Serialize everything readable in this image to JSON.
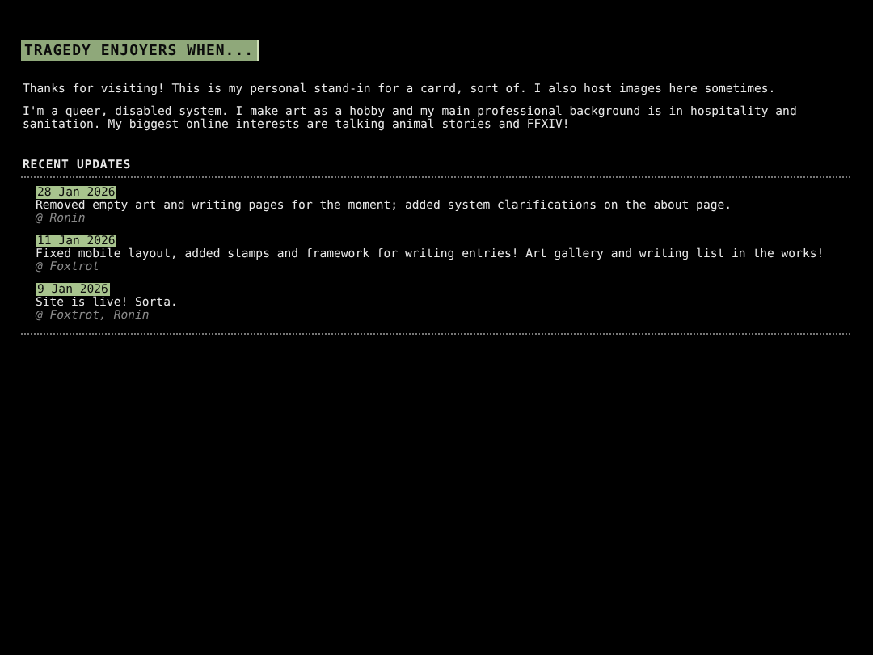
{
  "title": "TRAGEDY ENJOYERS WHEN...",
  "intro": [
    "Thanks for visiting! This is my personal stand-in for a carrd, sort of. I also host images here sometimes.",
    "I'm a queer, disabled system. I make art as a hobby and my main professional background is in hospitality and sanitation. My biggest online interests are talking animal stories and FFXIV!"
  ],
  "updates_heading": "RECENT UPDATES",
  "updates": [
    {
      "date": "28 Jan 2026",
      "text": "Removed empty art and writing pages for the moment; added system clarifications on the about page.",
      "author": "@ Ronin"
    },
    {
      "date": "11 Jan 2026",
      "text": "Fixed mobile layout, added stamps and framework for writing entries! Art gallery and writing list in the works!",
      "author": "@ Foxtrot"
    },
    {
      "date": "9 Jan 2026",
      "text": "Site is live! Sorta.",
      "author": "@ Foxtrot, Ronin"
    }
  ]
}
